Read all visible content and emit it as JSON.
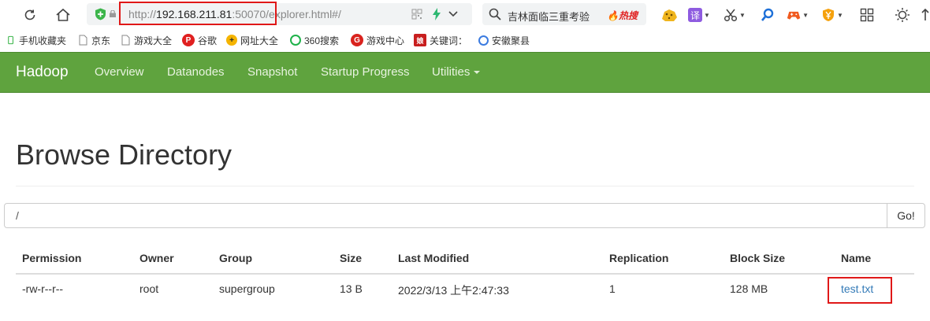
{
  "browser": {
    "address": {
      "protocol": "http://",
      "host": "192.168.211.81",
      "port": ":50070",
      "path": "/explorer.html#/"
    },
    "search": {
      "text": "吉林面临三重考验",
      "hot_label": "热搜"
    },
    "extensions": {
      "translate_label": "译"
    },
    "bookmarks": [
      {
        "label": "手机收藏夹",
        "icon": "phone-bookmark-icon"
      },
      {
        "label": "京东",
        "icon": "page-icon"
      },
      {
        "label": "游戏大全",
        "icon": "page-icon"
      },
      {
        "label": "谷歌",
        "icon": "google-icon",
        "color": "#e02020"
      },
      {
        "label": "网址大全",
        "icon": "web-nav-icon",
        "color": "#f5b400"
      },
      {
        "label": "360搜索",
        "icon": "search-360-icon",
        "color": "#1fb24a"
      },
      {
        "label": "游戏中心",
        "icon": "game-center-icon",
        "color": "#d9231e"
      },
      {
        "label": "关键词：",
        "icon": "keyword-icon",
        "color": "#c81e1e"
      },
      {
        "label": "安徽聚县",
        "icon": "earth-icon",
        "color": "#3b7be0"
      }
    ]
  },
  "navbar": {
    "brand": "Hadoop",
    "color": "#5fa33e",
    "items": [
      "Overview",
      "Datanodes",
      "Snapshot",
      "Startup Progress",
      "Utilities"
    ]
  },
  "page": {
    "title": "Browse Directory",
    "path_value": "/",
    "go_label": "Go!"
  },
  "table": {
    "columns": [
      "Permission",
      "Owner",
      "Group",
      "Size",
      "Last Modified",
      "Replication",
      "Block Size",
      "Name"
    ],
    "rows": [
      [
        "-rw-r--r--",
        "root",
        "supergroup",
        "13 B",
        "2022/3/13 上午2:47:33",
        "1",
        "128 MB",
        "test.txt"
      ]
    ]
  },
  "colors": {
    "highlight": "#e01818",
    "link": "#337ab7"
  }
}
